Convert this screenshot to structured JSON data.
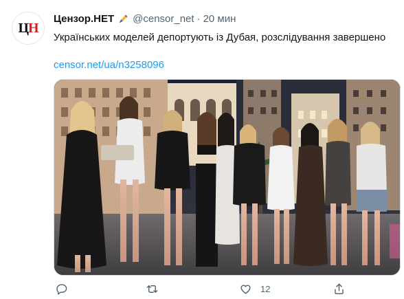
{
  "tweet": {
    "author_name": "Цензор.НЕТ",
    "author_handle": "@censor_net",
    "separator": "·",
    "time": "20 мин",
    "text": "Українських моделей депортують із Дубая, розслідування завершено",
    "link": "censor.net/ua/n3258096",
    "avatar_logo": {
      "letter1": "Ц",
      "letter2": "Н"
    },
    "badge_icon": "writing-hand-icon"
  },
  "actions": {
    "reply_icon": "reply-icon",
    "retweet_icon": "retweet-icon",
    "like_icon": "heart-icon",
    "like_count": "12",
    "share_icon": "share-icon"
  },
  "colors": {
    "link": "#1d9bf0",
    "secondary_text": "#536471",
    "logo_red": "#d61f1f"
  }
}
